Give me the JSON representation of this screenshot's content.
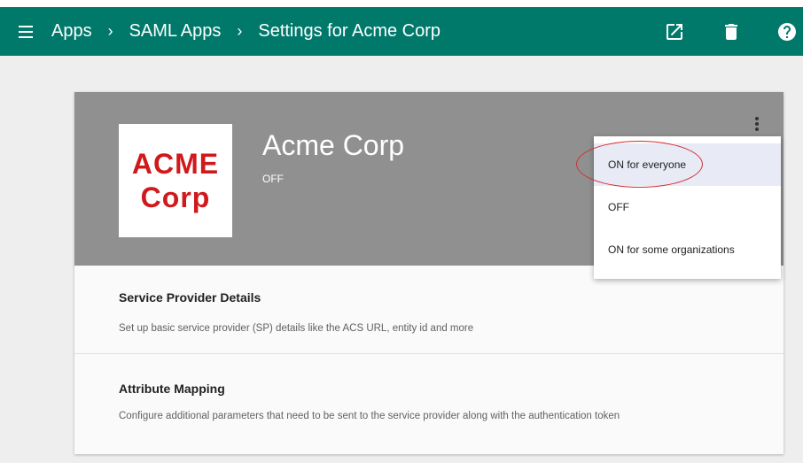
{
  "breadcrumb": {
    "items": [
      "Apps",
      "SAML Apps",
      "Settings for Acme Corp"
    ],
    "separator": "›"
  },
  "appbar": {
    "color": "#00796b",
    "icons": [
      "menu-icon",
      "open-in-new-icon",
      "delete-icon",
      "help-icon"
    ]
  },
  "app": {
    "logo_line1": "ACME",
    "logo_line2": "Corp",
    "name": "Acme Corp",
    "status": "OFF"
  },
  "sections": [
    {
      "title": "Service Provider Details",
      "description": "Set up basic service provider (SP) details like the ACS URL, entity id and more"
    },
    {
      "title": "Attribute Mapping",
      "description": "Configure additional parameters that need to be sent to the service provider along with the authentication token"
    }
  ],
  "status_menu": {
    "options": [
      "ON for everyone",
      "OFF",
      "ON for some organizations"
    ],
    "highlighted": "ON for everyone"
  },
  "colors": {
    "header_gray": "#909090",
    "logo_red": "#d0191b",
    "annotation_red": "#d32f2f"
  }
}
